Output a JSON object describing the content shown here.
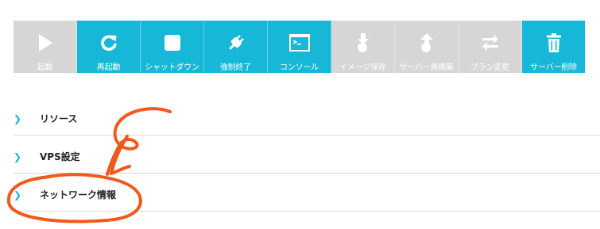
{
  "toolbar": {
    "accent_color": "#16b7d7",
    "disabled_color": "#d6d6d6",
    "buttons": [
      {
        "label": "起動",
        "icon": "play-icon",
        "enabled": false
      },
      {
        "label": "再起動",
        "icon": "restart-icon",
        "enabled": true
      },
      {
        "label": "シャットダウン",
        "icon": "stop-icon",
        "enabled": true
      },
      {
        "label": "強制終了",
        "icon": "unplug-icon",
        "enabled": true
      },
      {
        "label": "コンソール",
        "icon": "console-icon",
        "enabled": true
      },
      {
        "label": "イメージ保存",
        "icon": "image-save-icon",
        "enabled": false
      },
      {
        "label": "サーバー再構築",
        "icon": "rebuild-icon",
        "enabled": false
      },
      {
        "label": "プラン変更",
        "icon": "swap-icon",
        "enabled": false
      },
      {
        "label": "サーバー削除",
        "icon": "trash-icon",
        "enabled": true
      }
    ]
  },
  "sections": [
    {
      "title": "リソース",
      "chevron": "❯"
    },
    {
      "title": "VPS設定",
      "chevron": "❯"
    },
    {
      "title": "ネットワーク情報",
      "chevron": "❯"
    }
  ],
  "annotation": {
    "color": "#ef5a1c",
    "icon": "hand-drawn-arrow-and-circle"
  }
}
